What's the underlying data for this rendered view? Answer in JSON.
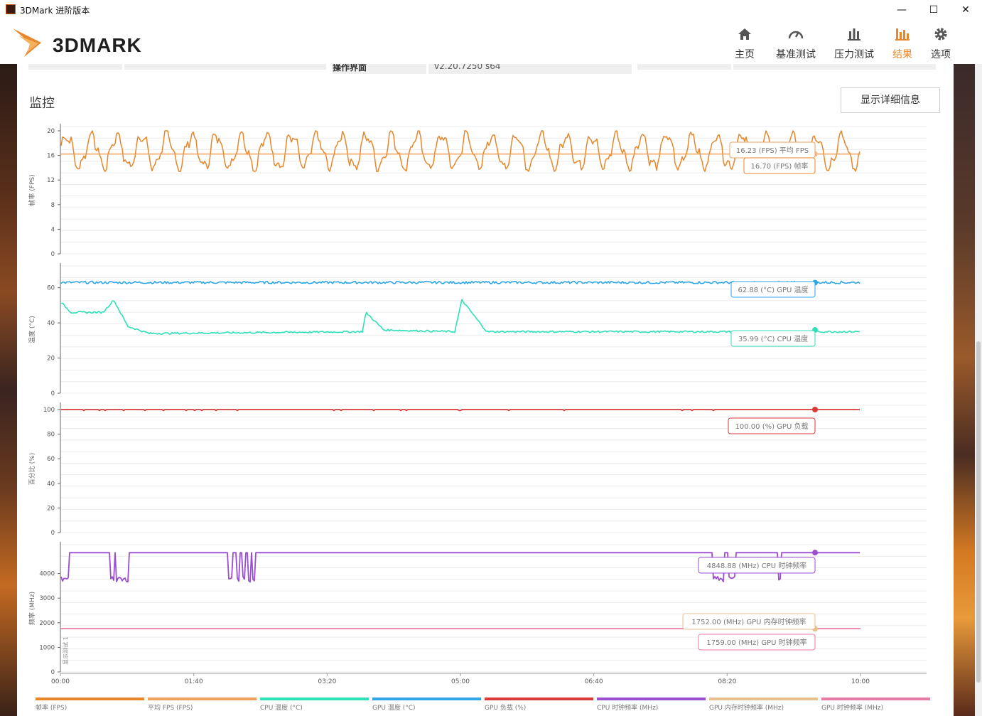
{
  "window": {
    "title": "3DMark 进阶版本",
    "minimize": "—",
    "maximize": "☐",
    "close": "✕"
  },
  "app": {
    "logo_text": "3DMARK",
    "accent": "#e8862a"
  },
  "nav": [
    {
      "label": "主页",
      "icon": "home-icon"
    },
    {
      "label": "基准测试",
      "icon": "gauge-icon"
    },
    {
      "label": "压力测试",
      "icon": "bar-chart-icon"
    },
    {
      "label": "结果",
      "icon": "results-icon",
      "active": true
    },
    {
      "label": "选项",
      "icon": "gear-icon"
    }
  ],
  "info_row": {
    "os_label": "操作界面",
    "os_value": "v2.20.7250 s64"
  },
  "monitor": {
    "title": "监控",
    "details_button": "显示详细信息"
  },
  "chart_data": [
    {
      "type": "line",
      "ylabel": "帧率 (FPS)",
      "ylim": [
        0,
        20
      ],
      "yticks": [
        0,
        4,
        8,
        12,
        16,
        20
      ],
      "series": [
        {
          "name": "帧率 (FPS)",
          "color": "#e8862a",
          "range": [
            13.5,
            20
          ],
          "mean": 16.7,
          "pattern": "oscillating"
        },
        {
          "name": "平均 FPS (FPS)",
          "color": "#f0a05a",
          "values": [
            16.23
          ]
        }
      ],
      "tooltips": [
        {
          "text": "16.23 (FPS) 平均 FPS",
          "color": "#e8a060"
        },
        {
          "text": "16.70 (FPS) 帧率",
          "color": "#e8862a"
        }
      ]
    },
    {
      "type": "line",
      "ylabel": "温度 (°C)",
      "ylim": [
        0,
        70
      ],
      "yticks": [
        0,
        20,
        40,
        60
      ],
      "series": [
        {
          "name": "GPU 温度 (°C)",
          "color": "#2ea6e8",
          "mean": 63,
          "range": [
            61.5,
            64
          ]
        },
        {
          "name": "CPU 温度 (°C)",
          "color": "#2ee0b8",
          "range": [
            34,
            53
          ],
          "points": [
            [
              0,
              52
            ],
            [
              15,
              46
            ],
            [
              60,
              46
            ],
            [
              75,
              53
            ],
            [
              95,
              38
            ],
            [
              125,
              34
            ],
            [
              425,
              35
            ],
            [
              430,
              46
            ],
            [
              455,
              36
            ],
            [
              555,
              35
            ],
            [
              565,
              53
            ],
            [
              600,
              35
            ],
            [
              1125,
              35
            ]
          ]
        }
      ],
      "tooltips": [
        {
          "text": "62.88 (°C) GPU 温度",
          "color": "#2ea6e8"
        },
        {
          "text": "35.99 (°C) CPU 温度",
          "color": "#2ee0b8"
        }
      ]
    },
    {
      "type": "line",
      "ylabel": "百分比 (%)",
      "ylim": [
        0,
        100
      ],
      "yticks": [
        0,
        20,
        40,
        60,
        80,
        100
      ],
      "series": [
        {
          "name": "GPU 负载 (%)",
          "color": "#d83a3a",
          "mean": 100,
          "range": [
            99,
            100
          ]
        }
      ],
      "tooltips": [
        {
          "text": "100.00 (%) GPU 负载",
          "color": "#d83a3a"
        }
      ]
    },
    {
      "type": "line",
      "ylabel": "频率 (MHz)",
      "ylim": [
        0,
        5000
      ],
      "yticks": [
        0,
        1000,
        2000,
        3000,
        4000
      ],
      "annotation": "显示测试 1",
      "series": [
        {
          "name": "CPU 时钟频率 (MHz)",
          "color": "#9a4ed0",
          "mean": 4848.88,
          "range": [
            3650,
            4850
          ]
        },
        {
          "name": "GPU 内存时钟频率 (MHz)",
          "color": "#e8c090",
          "values": [
            1752.0
          ]
        },
        {
          "name": "GPU 时钟频率 (MHz)",
          "color": "#e87aa8",
          "values": [
            1759.0
          ]
        }
      ],
      "tooltips": [
        {
          "text": "4848.88 (MHz) CPU 时钟频率",
          "color": "#9a4ed0"
        },
        {
          "text": "1752.00 (MHz) GPU 内存时钟频率",
          "color": "#e8c090"
        },
        {
          "text": "1759.00 (MHz) GPU 时钟频率",
          "color": "#e87aa8"
        }
      ]
    }
  ],
  "x_axis": {
    "ticks": [
      "00:00",
      "01:40",
      "03:20",
      "05:00",
      "06:40",
      "08:20",
      "10:00"
    ]
  },
  "legend": [
    {
      "label": "帧率 (FPS)",
      "color": "#e8862a"
    },
    {
      "label": "平均 FPS (FPS)",
      "color": "#f0a05a"
    },
    {
      "label": "CPU 温度 (°C)",
      "color": "#2ee0b8"
    },
    {
      "label": "GPU 温度 (°C)",
      "color": "#2ea6e8"
    },
    {
      "label": "GPU 负载 (%)",
      "color": "#d83a3a"
    },
    {
      "label": "CPU 时钟频率 (MHz)",
      "color": "#9a4ed0"
    },
    {
      "label": "GPU 内存时钟频率 (MHz)",
      "color": "#e8c090"
    },
    {
      "label": "GPU 时钟频率 (MHz)",
      "color": "#e87aa8"
    }
  ]
}
